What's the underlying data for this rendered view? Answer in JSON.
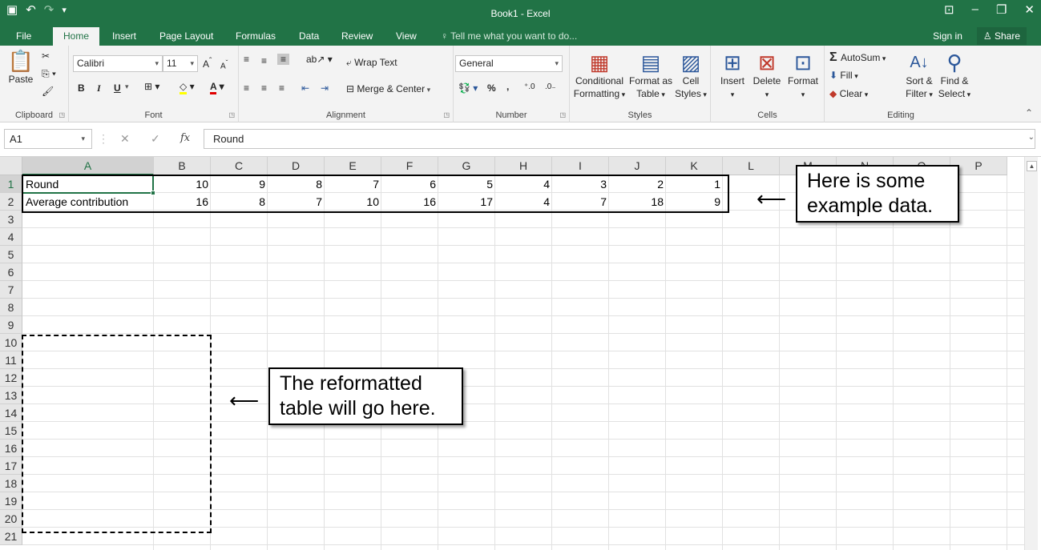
{
  "titlebar": {
    "title": "Book1 - Excel",
    "save_icon": "▣",
    "undo_icon": "↶",
    "redo_icon": "↷",
    "qat_more": "▾",
    "ribbon_display": "⊡",
    "minimize": "–",
    "restore": "❐",
    "close": "✕"
  },
  "tabs": [
    {
      "label": "File"
    },
    {
      "label": "Home"
    },
    {
      "label": "Insert"
    },
    {
      "label": "Page Layout"
    },
    {
      "label": "Formulas"
    },
    {
      "label": "Data"
    },
    {
      "label": "Review"
    },
    {
      "label": "View"
    }
  ],
  "tell_me": "Tell me what you want to do...",
  "sign_in": "Sign in",
  "share": "Share",
  "ribbon": {
    "clipboard": {
      "label": "Clipboard",
      "paste": "Paste"
    },
    "font": {
      "label": "Font",
      "name": "Calibri",
      "size": "11",
      "bold": "B",
      "italic": "I",
      "underline": "U"
    },
    "alignment": {
      "label": "Alignment",
      "wrap": "Wrap Text",
      "merge": "Merge & Center"
    },
    "number": {
      "label": "Number",
      "format": "General",
      "percent": "%",
      "comma": ","
    },
    "styles": {
      "label": "Styles",
      "cond1": "Conditional",
      "cond2": "Formatting",
      "fmt1": "Format as",
      "fmt2": "Table",
      "cell1": "Cell",
      "cell2": "Styles"
    },
    "cells": {
      "label": "Cells",
      "insert": "Insert",
      "delete": "Delete",
      "format": "Format"
    },
    "editing": {
      "label": "Editing",
      "autosum": "AutoSum",
      "fill": "Fill",
      "clear": "Clear",
      "sort1": "Sort &",
      "sort2": "Filter",
      "find1": "Find &",
      "find2": "Select"
    }
  },
  "formula_bar": {
    "name_box": "A1",
    "cancel": "✕",
    "enter": "✓",
    "fx": "fx",
    "content": "Round"
  },
  "columns": [
    "A",
    "B",
    "C",
    "D",
    "E",
    "F",
    "G",
    "H",
    "I",
    "J",
    "K",
    "L",
    "M",
    "N",
    "O",
    "P"
  ],
  "rows": [
    "1",
    "2",
    "3",
    "4",
    "5",
    "6",
    "7",
    "8",
    "9",
    "10",
    "11",
    "12",
    "13",
    "14",
    "15",
    "16",
    "17",
    "18",
    "19",
    "20",
    "21"
  ],
  "sheet": {
    "row1": {
      "label": "Round",
      "values": [
        "10",
        "9",
        "8",
        "7",
        "6",
        "5",
        "4",
        "3",
        "2",
        "1"
      ]
    },
    "row2": {
      "label": "Average contribution",
      "values": [
        "16",
        "8",
        "7",
        "10",
        "16",
        "17",
        "4",
        "7",
        "18",
        "9"
      ]
    }
  },
  "annotations": {
    "callout1_line1": "Here is some",
    "callout1_line2": "example data.",
    "callout2_line1": "The reformatted",
    "callout2_line2": "table will go here.",
    "arrow": "⟵"
  }
}
